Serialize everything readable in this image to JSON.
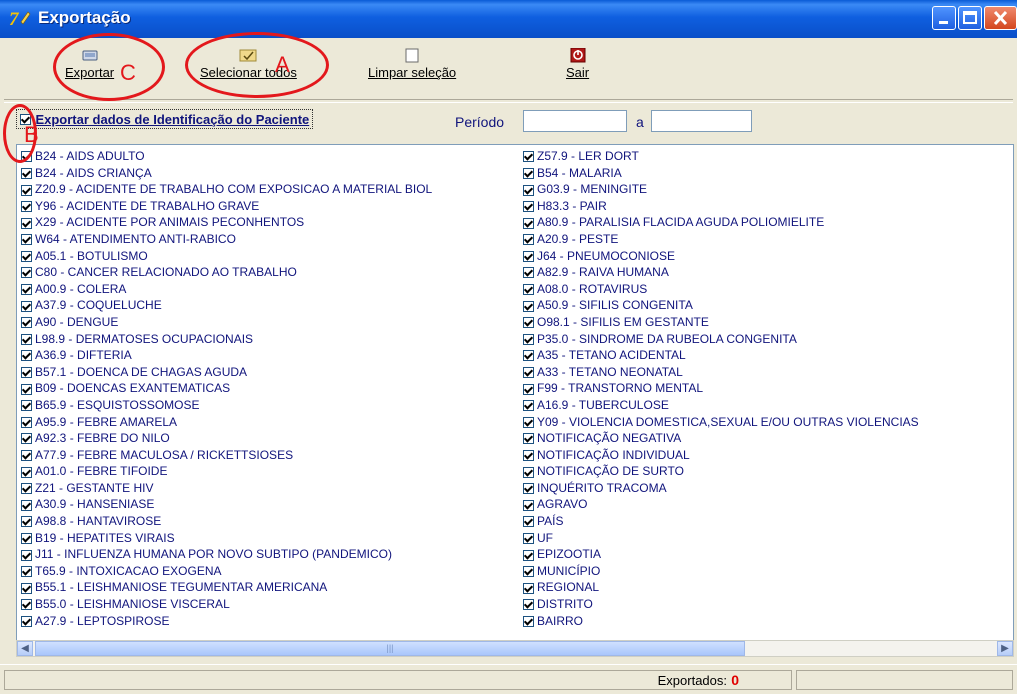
{
  "window": {
    "title": "Exportação",
    "icon": "app-logo-icon"
  },
  "toolbar": {
    "exportar": {
      "label": "Exportar",
      "icon": "export-icon"
    },
    "selecionar": {
      "label": "Selecionar todos",
      "icon": "select-all-icon"
    },
    "limpar": {
      "label": "Limpar seleção",
      "icon": "clear-selection-icon"
    },
    "sair": {
      "label": "Sair",
      "icon": "exit-icon"
    }
  },
  "identificacao": {
    "label": "Exportar dados de Identificação do Paciente",
    "checked": true
  },
  "periodo": {
    "label": "Período",
    "separator": "a",
    "from": "",
    "to": ""
  },
  "list_left": [
    "B24 - AIDS ADULTO",
    "B24 - AIDS CRIANÇA",
    "Z20.9 - ACIDENTE DE TRABALHO COM EXPOSICAO A MATERIAL BIOL",
    "Y96 - ACIDENTE DE TRABALHO GRAVE",
    "X29 - ACIDENTE POR ANIMAIS PECONHENTOS",
    "W64 - ATENDIMENTO ANTI-RABICO",
    "A05.1 - BOTULISMO",
    "C80 - CANCER RELACIONADO AO TRABALHO",
    "A00.9 - COLERA",
    "A37.9 - COQUELUCHE",
    "A90 - DENGUE",
    "L98.9 - DERMATOSES OCUPACIONAIS",
    "A36.9 - DIFTERIA",
    "B57.1 - DOENCA DE CHAGAS AGUDA",
    "B09 - DOENCAS EXANTEMATICAS",
    "B65.9 - ESQUISTOSSOMOSE",
    "A95.9 - FEBRE AMARELA",
    "A92.3 - FEBRE DO NILO",
    "A77.9 - FEBRE MACULOSA / RICKETTSIOSES",
    "A01.0 - FEBRE TIFOIDE",
    "Z21 - GESTANTE HIV",
    "A30.9 - HANSENIASE",
    "A98.8 - HANTAVIROSE",
    "B19 - HEPATITES VIRAIS",
    "J11 - INFLUENZA HUMANA POR NOVO SUBTIPO (PANDEMICO)",
    "T65.9 - INTOXICACAO EXOGENA",
    "B55.1 - LEISHMANIOSE TEGUMENTAR AMERICANA",
    "B55.0 - LEISHMANIOSE VISCERAL",
    "A27.9 - LEPTOSPIROSE"
  ],
  "list_right": [
    "Z57.9 - LER DORT",
    "B54 - MALARIA",
    "G03.9 - MENINGITE",
    "H83.3 - PAIR",
    "A80.9 - PARALISIA FLACIDA AGUDA POLIOMIELITE",
    "A20.9 - PESTE",
    "J64 - PNEUMOCONIOSE",
    "A82.9 - RAIVA HUMANA",
    "A08.0 - ROTAVIRUS",
    "A50.9 - SIFILIS CONGENITA",
    "O98.1 - SIFILIS EM GESTANTE",
    "P35.0 - SINDROME DA RUBEOLA CONGENITA",
    "A35 - TETANO ACIDENTAL",
    "A33 - TETANO NEONATAL",
    "F99 - TRANSTORNO MENTAL",
    "A16.9 - TUBERCULOSE",
    "Y09 - VIOLENCIA DOMESTICA,SEXUAL E/OU OUTRAS VIOLENCIAS",
    "NOTIFICAÇÃO NEGATIVA",
    "NOTIFICAÇÃO INDIVIDUAL",
    "NOTIFICAÇÃO DE SURTO",
    "INQUÉRITO TRACOMA",
    "AGRAVO",
    "PAÍS",
    "UF",
    "EPIZOOTIA",
    "MUNICÍPIO",
    "REGIONAL",
    "DISTRITO",
    "BAIRRO"
  ],
  "status": {
    "label": "Exportados:",
    "count": "0",
    "count_color": "#e00000"
  },
  "annotations": {
    "a": "A",
    "b": "B",
    "c": "C",
    "color": "#e3181c"
  }
}
